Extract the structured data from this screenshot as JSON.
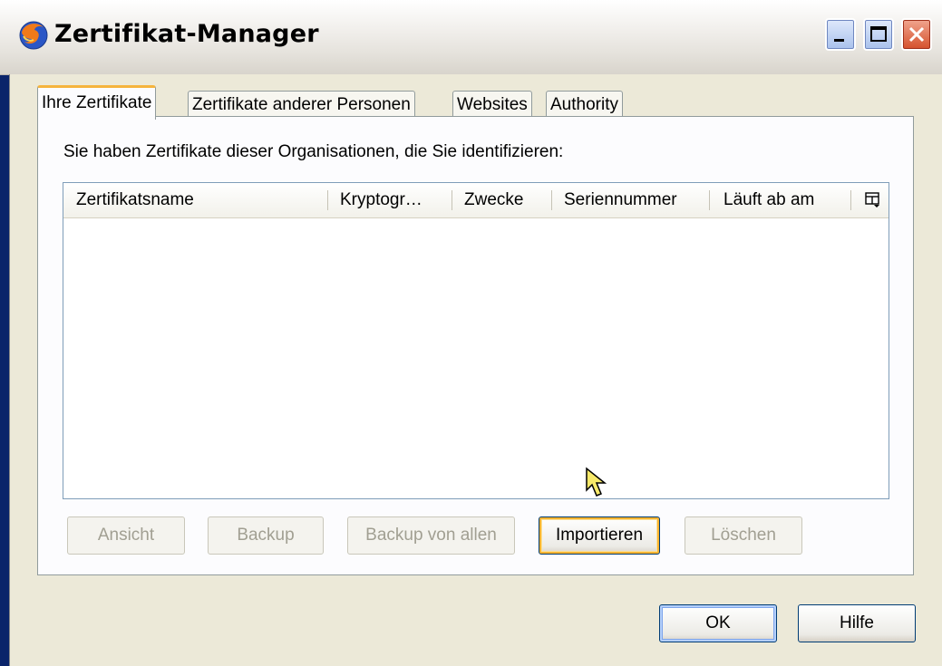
{
  "window": {
    "title": "Zertifikat-Manager",
    "icons": {
      "app": "firefox-icon",
      "minimize": "minimize-icon",
      "maximize": "maximize-icon",
      "close": "close-icon"
    }
  },
  "tabs": [
    {
      "label": "Ihre Zertifikate",
      "active": true
    },
    {
      "label": "Zertifikate anderer Personen",
      "active": false
    },
    {
      "label": "Websites",
      "active": false
    },
    {
      "label": "Authority",
      "active": false
    }
  ],
  "panel": {
    "intro": "Sie haben Zertifikate dieser Organisationen, die Sie identifizieren:",
    "columns": [
      "Zertifikatsname",
      "Kryptogr…",
      "Zwecke",
      "Seriennummer",
      "Läuft ab am"
    ],
    "column_picker_icon": "column-picker-icon",
    "rows": []
  },
  "actions": [
    {
      "label": "Ansicht",
      "enabled": false
    },
    {
      "label": "Backup",
      "enabled": false
    },
    {
      "label": "Backup von allen",
      "enabled": false
    },
    {
      "label": "Importieren",
      "enabled": true,
      "hovered": true
    },
    {
      "label": "Löschen",
      "enabled": false
    }
  ],
  "dialog_buttons": {
    "ok": "OK",
    "help": "Hilfe"
  },
  "colors": {
    "tab_active_accent": "#f5b43d",
    "button_border": "#003c74",
    "hover_highlight": "#f8b330",
    "focus_highlight": "#7ea5ec"
  }
}
